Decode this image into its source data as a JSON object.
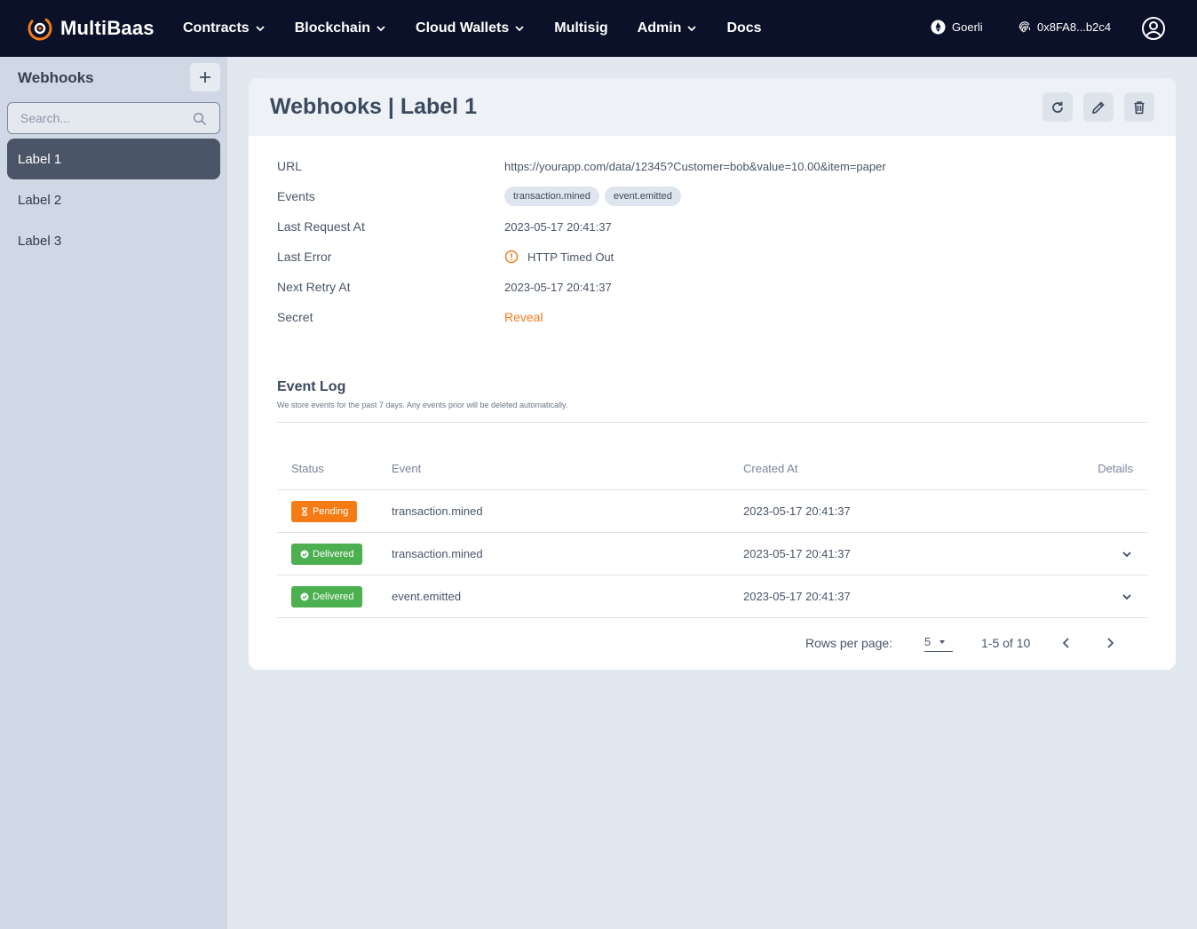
{
  "app": {
    "brand": "MultiBaas",
    "nav": [
      {
        "label": "Contracts",
        "has_dropdown": true
      },
      {
        "label": "Blockchain",
        "has_dropdown": true
      },
      {
        "label": "Cloud Wallets",
        "has_dropdown": true
      },
      {
        "label": "Multisig",
        "has_dropdown": false
      },
      {
        "label": "Admin",
        "has_dropdown": true
      },
      {
        "label": "Docs",
        "has_dropdown": false
      }
    ],
    "network": "Goerli",
    "wallet": "0x8FA8...b2c4"
  },
  "sidebar": {
    "title": "Webhooks",
    "search_placeholder": "Search...",
    "items": [
      {
        "label": "Label 1",
        "active": true
      },
      {
        "label": "Label 2",
        "active": false
      },
      {
        "label": "Label 3",
        "active": false
      }
    ]
  },
  "detail": {
    "title": "Webhooks | Label 1",
    "fields": {
      "url_label": "URL",
      "url_value": "https://yourapp.com/data/12345?Customer=bob&value=10.00&item=paper",
      "events_label": "Events",
      "events": [
        "transaction.mined",
        "event.emitted"
      ],
      "last_request_label": "Last Request At",
      "last_request_value": "2023-05-17 20:41:37",
      "last_error_label": "Last Error",
      "last_error_value": "HTTP Timed Out",
      "next_retry_label": "Next Retry At",
      "next_retry_value": "2023-05-17 20:41:37",
      "secret_label": "Secret",
      "secret_action": "Reveal"
    }
  },
  "event_log": {
    "title": "Event Log",
    "subtitle": "We store events for the past 7 days. Any events prior will be deleted automatically.",
    "columns": [
      "Status",
      "Event",
      "Created At",
      "Details"
    ],
    "rows": [
      {
        "status": "Pending",
        "status_color": "#f57c14",
        "event": "transaction.mined",
        "created_at": "2023-05-17 20:41:37",
        "expandable": false
      },
      {
        "status": "Delivered",
        "status_color": "#4caf50",
        "event": "transaction.mined",
        "created_at": "2023-05-17 20:41:37",
        "expandable": true
      },
      {
        "status": "Delivered",
        "status_color": "#4caf50",
        "event": "event.emitted",
        "created_at": "2023-05-17 20:41:37",
        "expandable": true
      }
    ],
    "pagination": {
      "rows_per_page_label": "Rows per page:",
      "rows_per_page": "5",
      "range": "1-5 of 10"
    }
  },
  "colors": {
    "accent": "#f07d1a",
    "nav_bg": "#0a1128",
    "sidebar_active": "#4a5568"
  }
}
